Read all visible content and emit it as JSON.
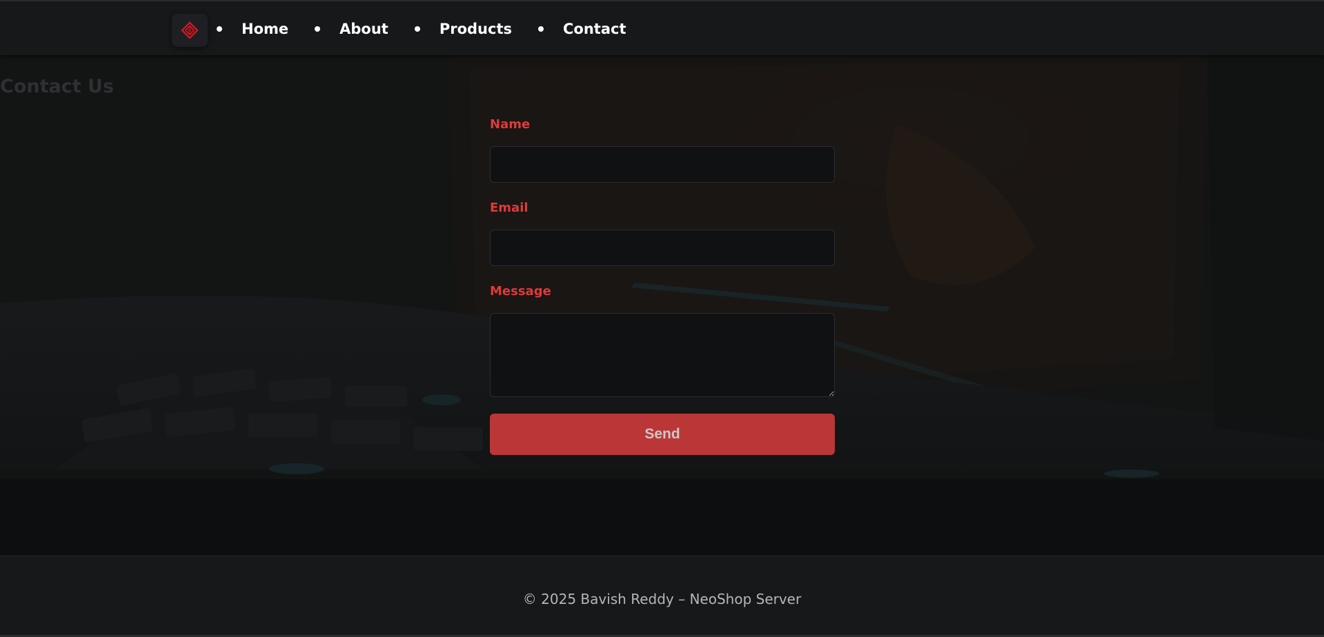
{
  "nav": {
    "logo_icon": "diamond-emblem-icon",
    "items": [
      {
        "label": "Home"
      },
      {
        "label": "About"
      },
      {
        "label": "Products"
      },
      {
        "label": "Contact"
      }
    ]
  },
  "hero": {
    "title": "Contact Us",
    "background": "dark photo of a laptop and keyboard"
  },
  "form": {
    "name_label": "Name",
    "name_value": "",
    "email_label": "Email",
    "email_value": "",
    "message_label": "Message",
    "message_value": "",
    "submit_label": "Send"
  },
  "footer": {
    "text": "© 2025 Bavish Reddy – NeoShop Server"
  },
  "colors": {
    "accent": "#e03a3a",
    "button": "#bb3737",
    "background": "#0d0e0f",
    "header": "#17181a"
  }
}
